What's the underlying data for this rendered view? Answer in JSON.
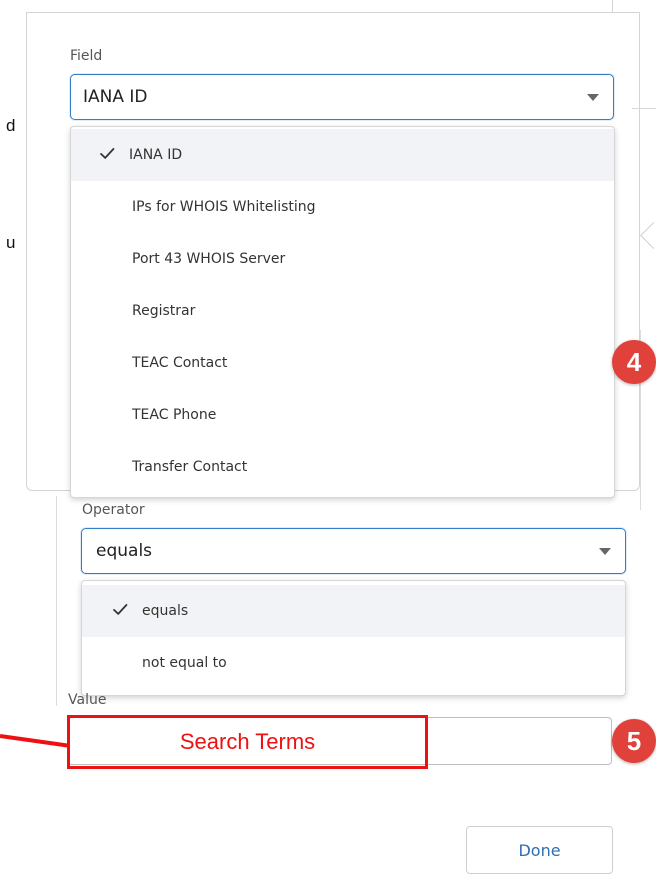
{
  "left_fragments": [
    "d",
    "u"
  ],
  "field": {
    "label": "Field",
    "selected": "IANA ID",
    "options": [
      {
        "label": "IANA ID",
        "selected": true
      },
      {
        "label": "IPs for WHOIS Whitelisting",
        "selected": false
      },
      {
        "label": "Port 43 WHOIS Server",
        "selected": false
      },
      {
        "label": "Registrar",
        "selected": false
      },
      {
        "label": "TEAC Contact",
        "selected": false
      },
      {
        "label": "TEAC Phone",
        "selected": false
      },
      {
        "label": "Transfer Contact",
        "selected": false
      }
    ]
  },
  "operator": {
    "label": "Operator",
    "selected": "equals",
    "options": [
      {
        "label": "equals",
        "selected": true
      },
      {
        "label": "not equal to",
        "selected": false
      }
    ]
  },
  "value": {
    "label": "Value",
    "annotation": "Search Terms"
  },
  "badges": {
    "field_step": "4",
    "value_step": "5"
  },
  "done_button": "Done",
  "colors": {
    "accent": "#2f7ec7",
    "annotation_red": "#ee1111",
    "badge": "#e0413a",
    "link_blue": "#2f6db5"
  }
}
